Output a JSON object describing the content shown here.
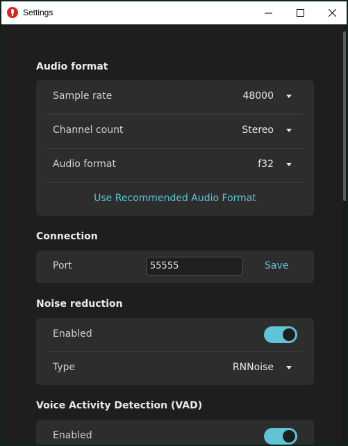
{
  "window": {
    "title": "Settings"
  },
  "audio_format": {
    "section_title": "Audio format",
    "sample_rate": {
      "label": "Sample rate",
      "value": "48000"
    },
    "channel_count": {
      "label": "Channel count",
      "value": "Stereo"
    },
    "format": {
      "label": "Audio format",
      "value": "f32"
    },
    "recommend_label": "Use Recommended Audio Format"
  },
  "connection": {
    "section_title": "Connection",
    "port_label": "Port",
    "port_value": "55555",
    "save_label": "Save"
  },
  "noise_reduction": {
    "section_title": "Noise reduction",
    "enabled_label": "Enabled",
    "enabled": true,
    "type_label": "Type",
    "type_value": "RNNoise"
  },
  "vad": {
    "section_title": "Voice Activity Detection (VAD)",
    "enabled_label": "Enabled",
    "enabled": true
  },
  "colors": {
    "accent": "#5ec4d6",
    "background": "#1e1e1e",
    "card": "#2d2d2d",
    "app_icon": "#d7261f"
  }
}
